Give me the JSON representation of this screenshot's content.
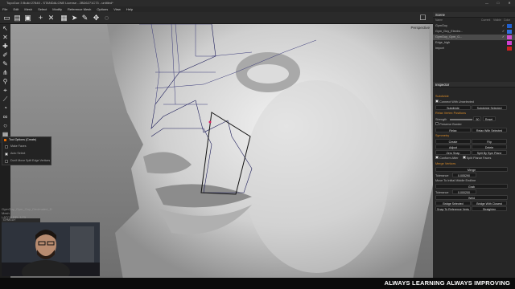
{
  "window": {
    "title": "TopoGun 3 Build 27840 - STANDALONE License - 2BD6271C73 - untitled*",
    "controls": [
      "—",
      "□",
      "✕"
    ]
  },
  "menu": [
    "File",
    "Edit",
    "Mesh",
    "Select",
    "Modify",
    "Reference Mesh",
    "Options",
    "View",
    "Help"
  ],
  "toolbar": {
    "icons": [
      "new-file-icon",
      "open-icon",
      "save-icon",
      "add-icon",
      "close-x-icon",
      "grid-icon",
      "pointer-icon",
      "brush-icon",
      "transform-icon",
      "lasso-icon"
    ]
  },
  "viewport": {
    "camera_label": "Perspective"
  },
  "tool_options": {
    "title": "Tool Options (Create)",
    "items": [
      {
        "label": "Make Faces",
        "checked": false
      },
      {
        "label": "Auto Select",
        "checked": true
      },
      {
        "label": "Don't Move Split Edge Vertices",
        "checked": false
      }
    ]
  },
  "bottom_info": {
    "line1": "GymGuy_Gym_Guy_Decimated_D",
    "line2": "Mesh",
    "line3": "LATCH.BEL 1/75",
    "mesh_label": "GYMGUY"
  },
  "scene": {
    "title": "Scene",
    "columns": [
      "Name",
      "Current",
      "Visible",
      "Color"
    ],
    "items": [
      {
        "label": "GymGuy",
        "selected": false,
        "color": "#2060d0"
      },
      {
        "label": "Gym_Guy_Electro...",
        "selected": false,
        "color": "#3070e0"
      },
      {
        "label": "GymGuy_Gym_G...",
        "selected": true,
        "color": "#d050d0"
      },
      {
        "label": "Edge_high",
        "selected": false,
        "color": "#d040d0"
      },
      {
        "label": "Import",
        "selected": false,
        "color": "#cc2020"
      }
    ]
  },
  "inspector": {
    "title": "Inspector",
    "subdivide": {
      "header": "Subdivide",
      "checkbox": "Connect With Unselected",
      "buttons": [
        "Subdivide",
        "Subdivide Selected"
      ]
    },
    "relax": {
      "header": "Relax Vertex Positions",
      "strength_label": "Strength",
      "value": "50",
      "reset": "Reset",
      "preserve": "Preserve Border",
      "buttons": [
        "Relax",
        "Relax With Selected"
      ]
    },
    "symmetry": {
      "header": "Symmetry",
      "buttons": [
        "Create",
        "Flip",
        "Adjust",
        "Delete",
        "Zero Snap",
        "Split By Sym Plane"
      ],
      "checks": [
        "Conform After",
        "Split Planar Faces"
      ]
    },
    "merge": {
      "header": "Merge Vertices",
      "button": "Merge",
      "tolerance_label": "Tolerance",
      "tolerance_value": "0.005290",
      "move_to_label": "Move To",
      "move_options": [
        "Initial",
        "Middle",
        "Endline"
      ],
      "grab": "Grab",
      "tolerance2_value": "0.000200",
      "weld": "Weld"
    },
    "bottom_buttons": [
      "Bridge Selected",
      "Bridge With Closest",
      "Snap To Reference Verts",
      "Straighten"
    ]
  },
  "footer": {
    "slogan": "ALWAYS LEARNING ALWAYS IMPROVING"
  }
}
